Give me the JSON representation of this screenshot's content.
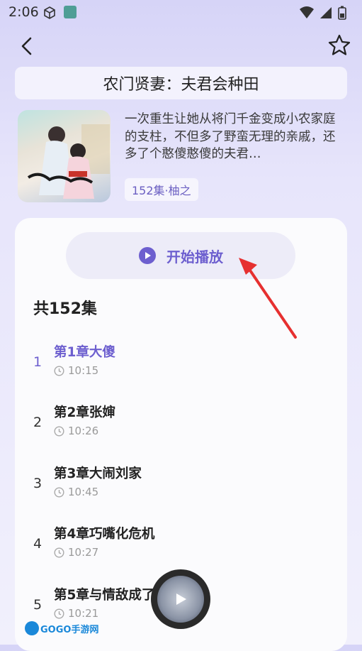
{
  "status_bar": {
    "time": "2:06"
  },
  "title": "农门贤妻：夫君会种田",
  "description": "一次重生让她从将门千金变成小农家庭的支柱，不但多了野蛮无理的亲戚，还多了个憨傻憨傻的夫君…",
  "tag": "152集·柚之",
  "play_button_label": "开始播放",
  "episode_count": "共152集",
  "episodes": [
    {
      "num": "1",
      "title": "第1章大傻",
      "time": "10:15",
      "active": true
    },
    {
      "num": "2",
      "title": "第2章张婶",
      "time": "10:26",
      "active": false
    },
    {
      "num": "3",
      "title": "第3章大闹刘家",
      "time": "10:45",
      "active": false
    },
    {
      "num": "4",
      "title": "第4章巧嘴化危机",
      "time": "10:27",
      "active": false
    },
    {
      "num": "5",
      "title": "第5章与情敌成了",
      "time": "10:21",
      "active": false
    }
  ],
  "watermark": "GOGO手游网",
  "colors": {
    "accent": "#6d5fcf",
    "arrow": "#e63030"
  },
  "icons": [
    "back-icon",
    "star-icon",
    "play-icon",
    "clock-icon",
    "mini-player-play-icon"
  ]
}
